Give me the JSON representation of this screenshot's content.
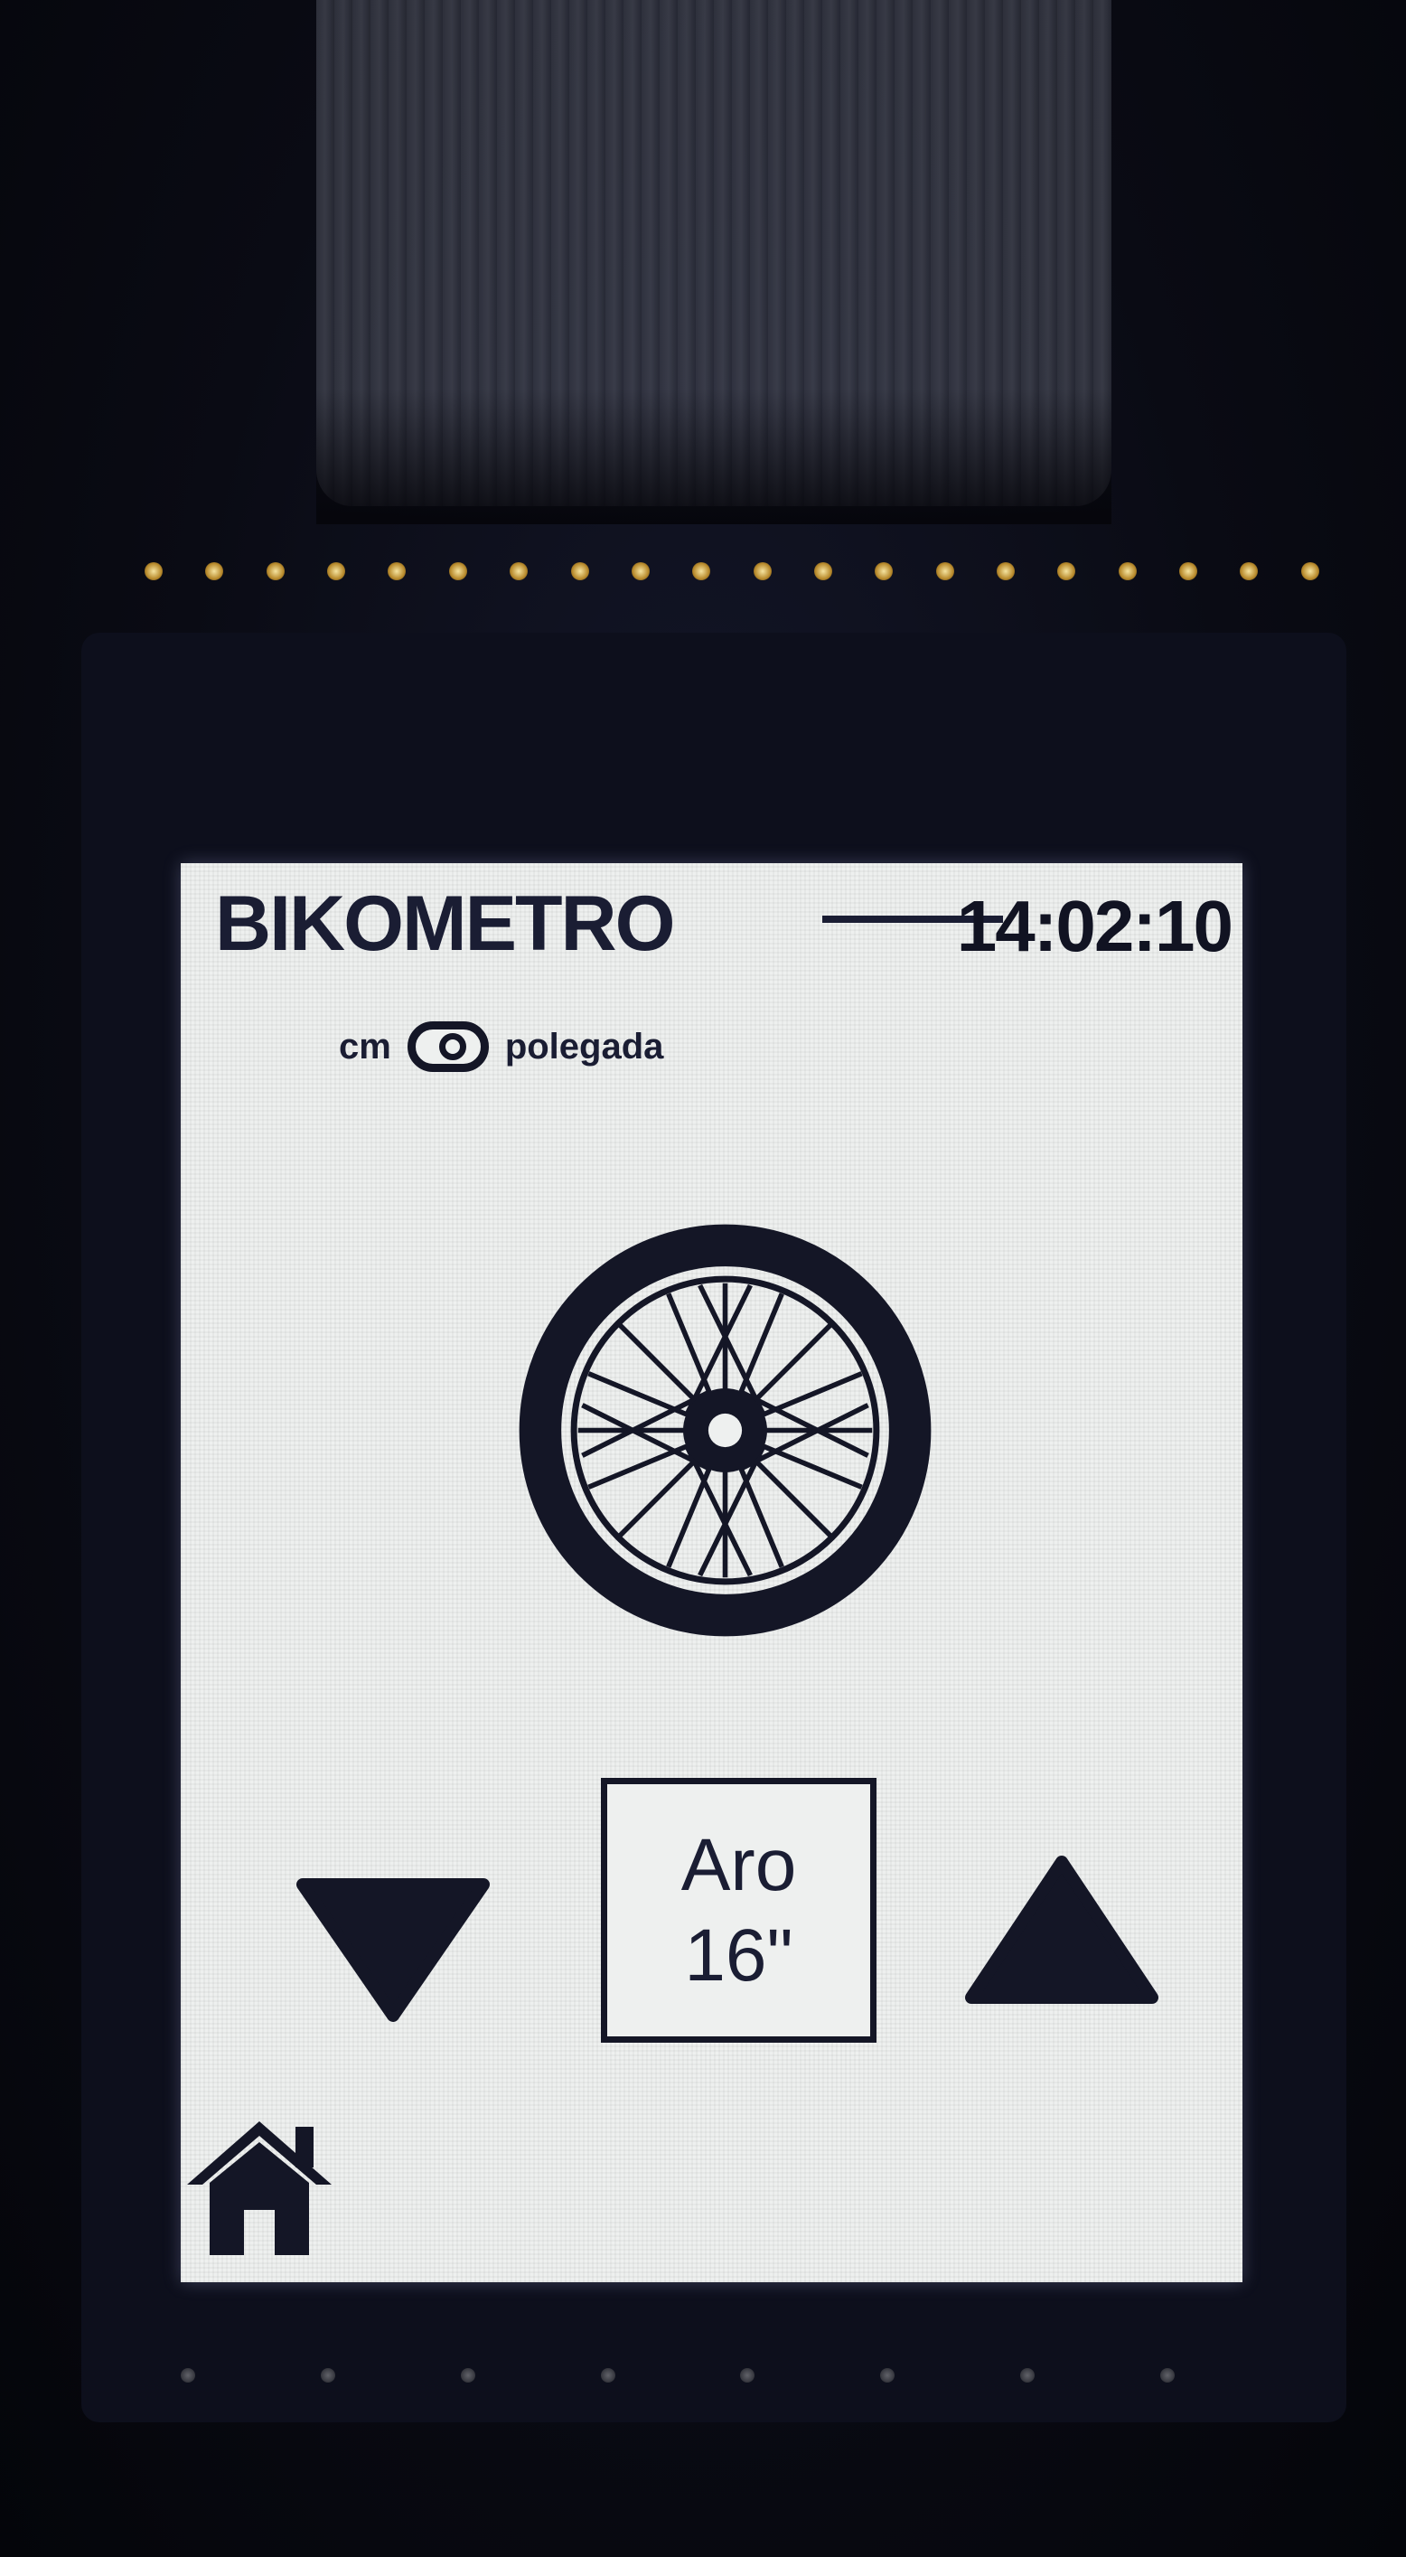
{
  "app": {
    "title": "BIKOMETRO",
    "clock": "14:02:10"
  },
  "units": {
    "left_label": "cm",
    "right_label": "polegada",
    "selected": "polegada"
  },
  "wheel": {
    "icon": "bicycle-wheel-icon"
  },
  "size_selector": {
    "label": "Aro",
    "value": "16\"",
    "decrease_icon": "triangle-down-icon",
    "increase_icon": "triangle-up-icon"
  },
  "nav": {
    "home_icon": "home-icon"
  },
  "colors": {
    "screen_background": "#eef0ef",
    "ink": "#141626",
    "bezel": "#0d0f1c"
  }
}
